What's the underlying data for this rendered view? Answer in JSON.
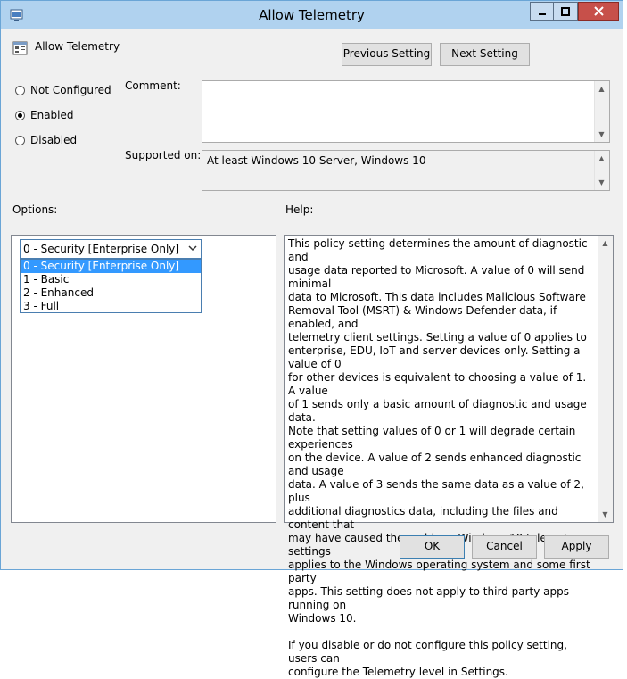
{
  "window": {
    "title": "Allow Telemetry",
    "controls": {
      "minimize": "minimize",
      "maximize": "maximize",
      "close": "close"
    }
  },
  "header": {
    "policy_name": "Allow Telemetry",
    "prev_label": "Previous Setting",
    "next_label": "Next Setting"
  },
  "state": {
    "options": [
      "Not Configured",
      "Enabled",
      "Disabled"
    ],
    "selected": "Enabled"
  },
  "comment": {
    "label": "Comment:",
    "value": ""
  },
  "supported": {
    "label": "Supported on:",
    "value": "At least Windows 10 Server, Windows 10"
  },
  "options_section": {
    "label": "Options:",
    "select_value": "0 - Security [Enterprise Only]",
    "items": [
      "0 - Security [Enterprise Only]",
      "1 - Basic",
      "2 - Enhanced",
      "3 - Full"
    ],
    "highlighted_index": 0
  },
  "help_section": {
    "label": "Help:",
    "text": "This policy setting determines the amount of diagnostic and\nusage data reported to Microsoft. A value of 0 will send minimal\ndata to Microsoft. This data includes Malicious Software\nRemoval Tool (MSRT) & Windows Defender data, if enabled, and\ntelemetry client settings. Setting a value of 0 applies to\nenterprise, EDU, IoT and server devices only. Setting a value of 0\nfor other devices is equivalent to choosing a value of 1. A value\nof 1 sends only a basic amount of diagnostic and usage data.\nNote that setting values of 0 or 1 will degrade certain experiences\non the device. A value of 2 sends enhanced diagnostic and usage\ndata. A value of 3 sends the same data as a value of 2, plus\nadditional diagnostics data, including the files and content that\nmay have caused the problem. Windows 10 telemetry settings\napplies to the Windows operating system and some first party\napps. This setting does not apply to third party apps running on\nWindows 10.\n\nIf you disable or do not configure this policy setting, users can\nconfigure the Telemetry level in Settings."
  },
  "footer": {
    "ok_label": "OK",
    "cancel_label": "Cancel",
    "apply_label": "Apply"
  },
  "icons": {
    "app": "policy-settings-icon",
    "header": "policy-setting-icon"
  }
}
